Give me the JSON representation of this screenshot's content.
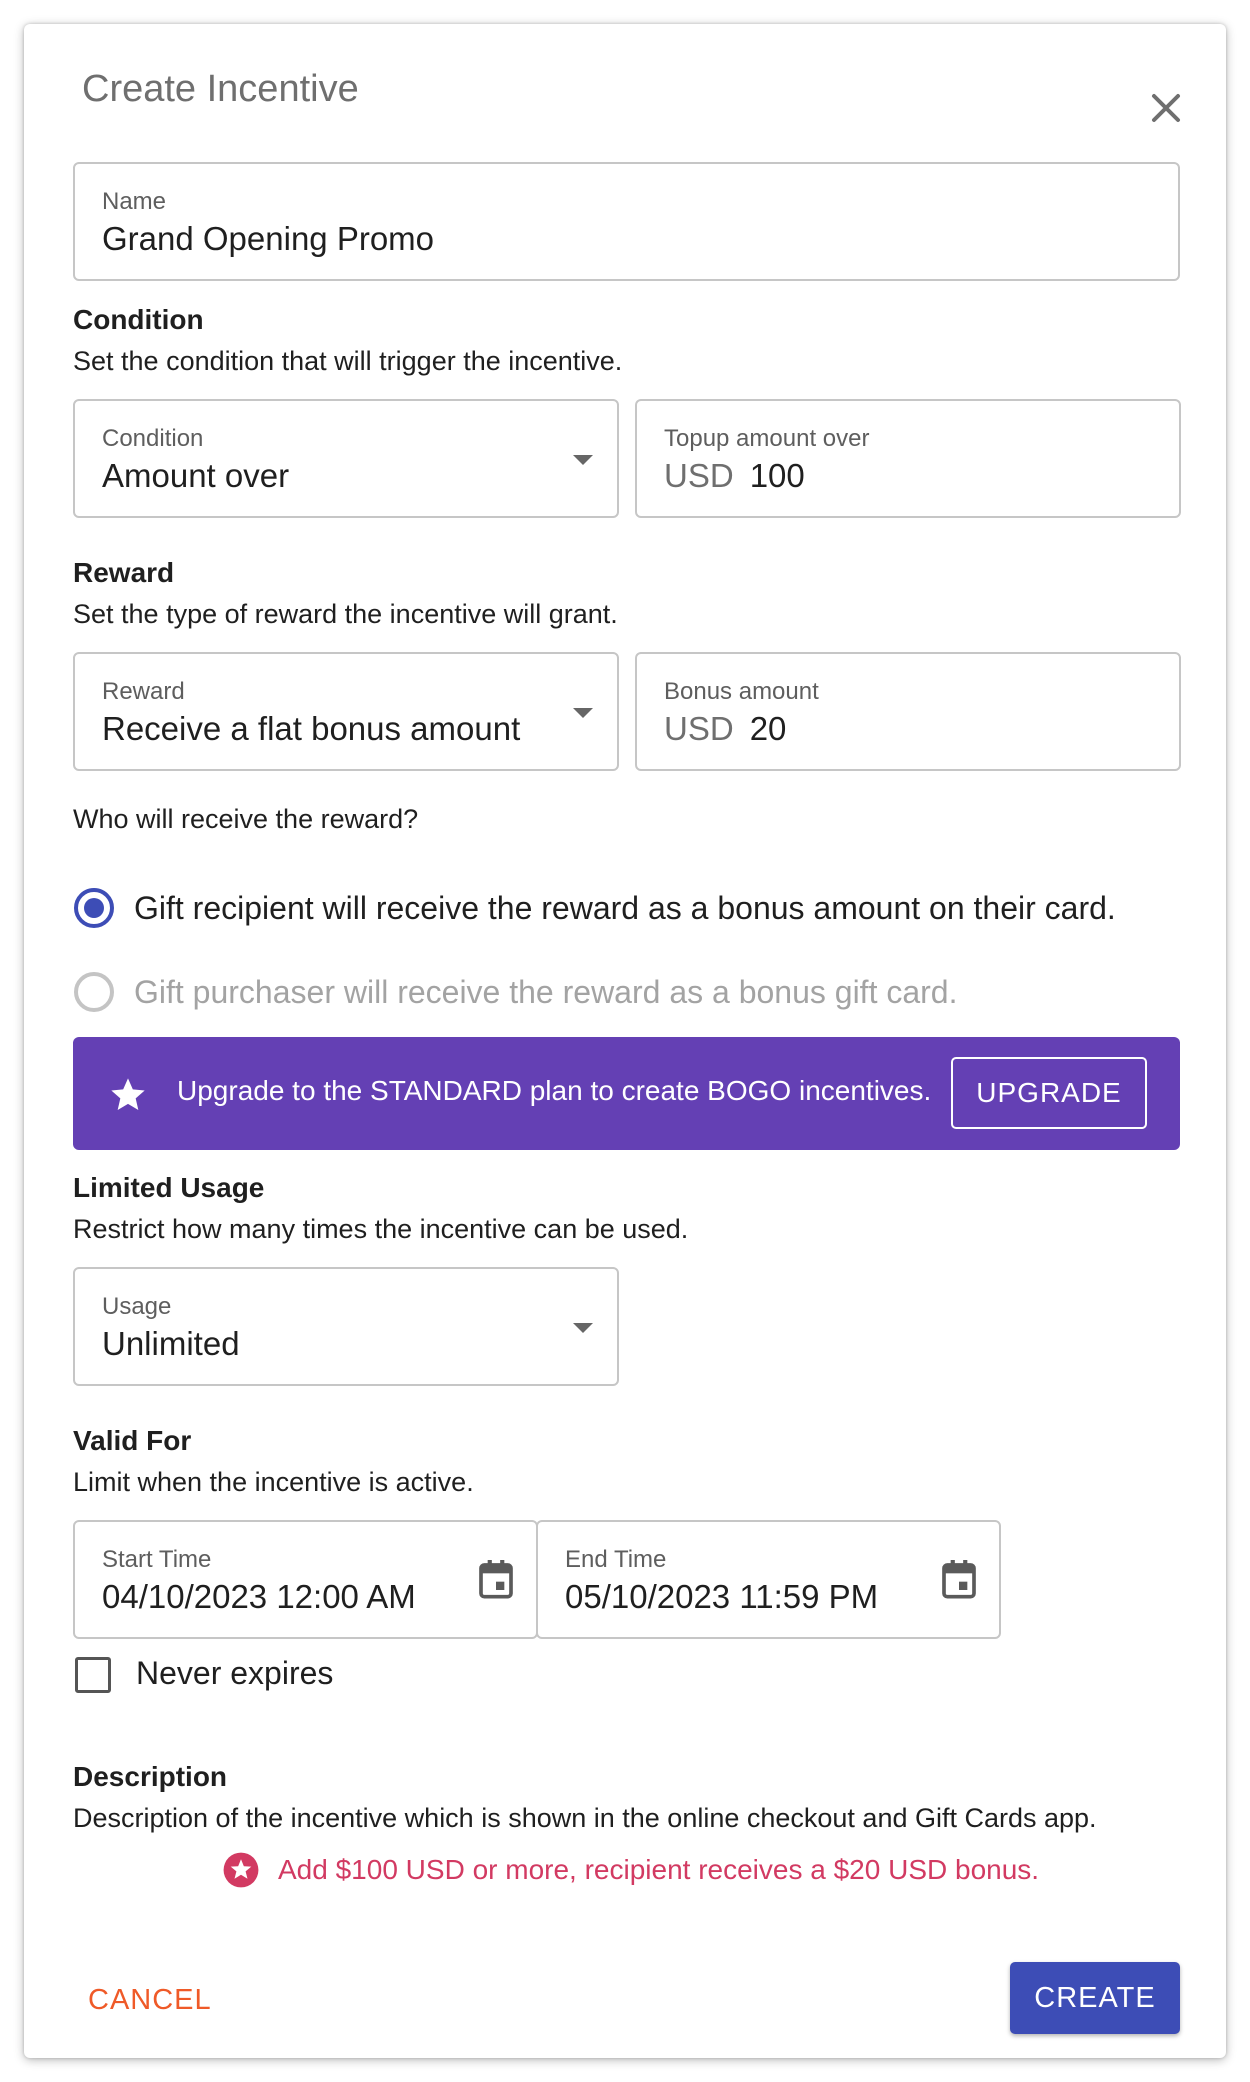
{
  "dialog": {
    "title": "Create Incentive",
    "close_icon": "close-icon"
  },
  "name_field": {
    "label": "Name",
    "value": "Grand Opening Promo"
  },
  "condition": {
    "title": "Condition",
    "description": "Set the condition that will trigger the incentive.",
    "select": {
      "label": "Condition",
      "value": "Amount over"
    },
    "amount": {
      "label": "Topup amount over",
      "currency": "USD",
      "value": "100"
    }
  },
  "reward": {
    "title": "Reward",
    "description": "Set the type of reward the incentive will grant.",
    "select": {
      "label": "Reward",
      "value": "Receive a flat bonus amount"
    },
    "amount": {
      "label": "Bonus amount",
      "currency": "USD",
      "value": "20"
    },
    "question": "Who will receive the reward?",
    "options": [
      {
        "label": "Gift recipient will receive the reward as a bonus amount on their card.",
        "selected": true,
        "disabled": false
      },
      {
        "label": "Gift purchaser will receive the reward as a bonus gift card.",
        "selected": false,
        "disabled": true
      }
    ]
  },
  "upgrade_banner": {
    "icon": "star-icon",
    "message": "Upgrade to the STANDARD plan to create BOGO incentives.",
    "button_label": "UPGRADE",
    "color": "#6440b4"
  },
  "limited_usage": {
    "title": "Limited Usage",
    "description": "Restrict how many times the incentive can be used.",
    "select": {
      "label": "Usage",
      "value": "Unlimited"
    }
  },
  "valid_for": {
    "title": "Valid For",
    "description": "Limit when the incentive is active.",
    "start": {
      "label": "Start Time",
      "value": "04/10/2023 12:00 AM",
      "icon": "calendar-icon"
    },
    "end": {
      "label": "End Time",
      "value": "05/10/2023 11:59 PM",
      "icon": "calendar-icon"
    },
    "never_expires": {
      "label": "Never expires",
      "checked": false
    }
  },
  "description": {
    "title": "Description",
    "text": "Description of the incentive which is shown in the online checkout and Gift Cards app.",
    "preview": "Add $100 USD or more, recipient receives a $20 USD bonus.",
    "preview_icon": "star-badge-icon",
    "preview_color": "#d23a62"
  },
  "actions": {
    "cancel_label": "CANCEL",
    "create_label": "CREATE",
    "cancel_color": "#ef5a28",
    "create_color": "#3d4db6"
  }
}
